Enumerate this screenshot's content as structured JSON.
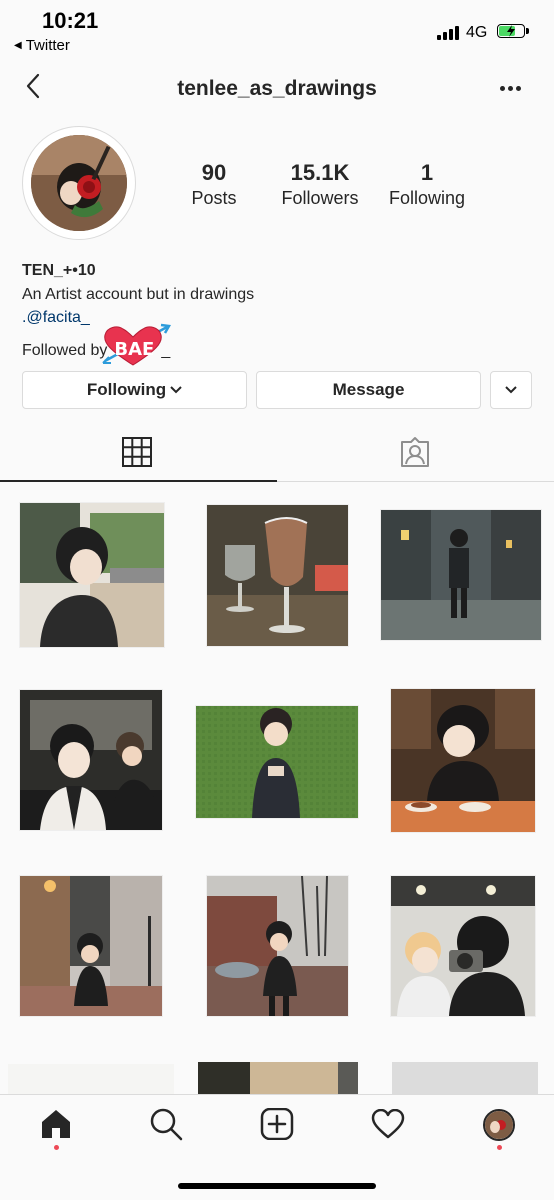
{
  "status_bar": {
    "time": "10:21",
    "back_app": "Twitter",
    "network": "4G"
  },
  "header": {
    "username": "tenlee_as_drawings"
  },
  "stats": [
    {
      "value": "90",
      "label": "Posts"
    },
    {
      "value": "15.1K",
      "label": "Followers"
    },
    {
      "value": "1",
      "label": "Following"
    }
  ],
  "bio": {
    "name": "TEN_+•10",
    "description": "An Artist account but in drawings",
    "link": ".@facita_",
    "followed_by": "Followed by",
    "sticker_text": "BAE",
    "sticker_trailing": "_"
  },
  "actions": {
    "following_label": "Following",
    "message_label": "Message"
  },
  "tabs": [
    {
      "name": "grid",
      "icon": "grid-icon",
      "active": true
    },
    {
      "name": "tagged",
      "icon": "tagged-icon",
      "active": false
    }
  ],
  "posts": [
    {
      "scene": "boy with glasses on street",
      "colors": [
        "#d8d2c6",
        "#2b2b2b",
        "#6f8f5a"
      ]
    },
    {
      "scene": "wine glasses on table",
      "colors": [
        "#3f3a2f",
        "#b07a5c",
        "#cfcfc8"
      ]
    },
    {
      "scene": "boy in night alley",
      "colors": [
        "#3c4446",
        "#23272a",
        "#9aa3a0"
      ]
    },
    {
      "scene": "boy in car",
      "colors": [
        "#30302c",
        "#f0ede8",
        "#1c1c1c"
      ]
    },
    {
      "scene": "boy on grass",
      "colors": [
        "#5b8a3c",
        "#2a2d35",
        "#e8d8c8"
      ]
    },
    {
      "scene": "boy at dinner",
      "colors": [
        "#4a3526",
        "#f2e9de",
        "#d57a44"
      ]
    },
    {
      "scene": "boy on rainy street",
      "colors": [
        "#8c7464",
        "#b9b2ac",
        "#1e1e1e"
      ]
    },
    {
      "scene": "boy on wet street",
      "colors": [
        "#7e4a3e",
        "#c8c6c2",
        "#202020"
      ]
    },
    {
      "scene": "two boys with camera",
      "colors": [
        "#dad9d4",
        "#222",
        "#f0c98f"
      ]
    }
  ],
  "nav": [
    {
      "name": "home",
      "icon": "home-icon",
      "active": true
    },
    {
      "name": "search",
      "icon": "search-icon"
    },
    {
      "name": "new-post",
      "icon": "plus-square-icon"
    },
    {
      "name": "activity",
      "icon": "heart-icon",
      "badge": true
    },
    {
      "name": "profile",
      "icon": "profile-avatar-icon",
      "badge": true
    }
  ],
  "colors": {
    "link": "#00376b",
    "badge": "#ed4956",
    "sticker_heart": "#e8334f",
    "sticker_arrow": "#2d9cdb"
  }
}
